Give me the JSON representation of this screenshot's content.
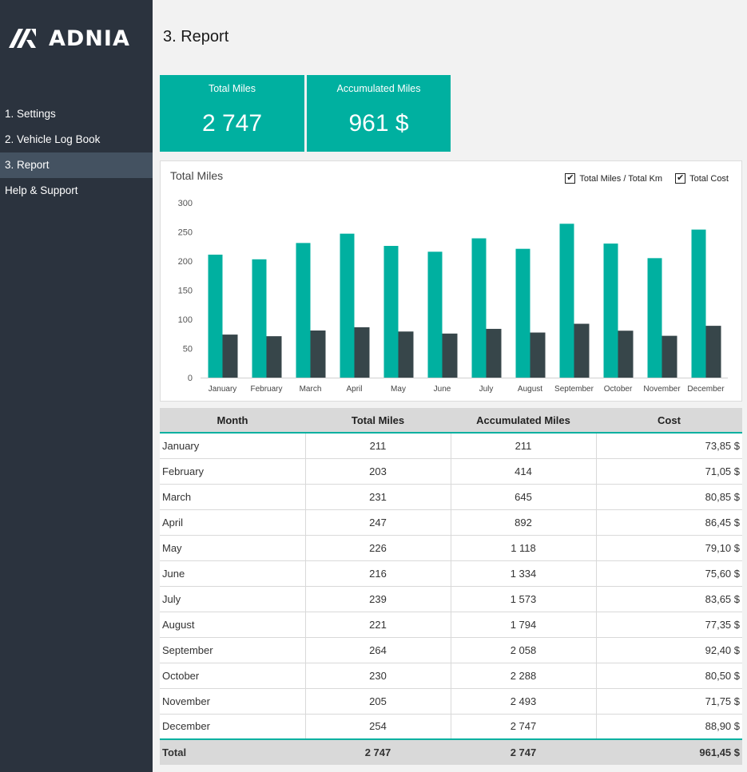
{
  "app": {
    "logo_text": "ADNIA",
    "page_title": "3. Report"
  },
  "sidebar": {
    "items": [
      {
        "label": "1. Settings",
        "active": false
      },
      {
        "label": "2. Vehicle Log Book",
        "active": false
      },
      {
        "label": "3. Report",
        "active": true
      },
      {
        "label": "Help & Support",
        "active": false
      }
    ]
  },
  "kpis": [
    {
      "label": "Total Miles",
      "value": "2 747"
    },
    {
      "label": "Accumulated Miles",
      "value": "961 $"
    }
  ],
  "colors": {
    "accent": "#00b0a0",
    "dark_series": "#37464a",
    "sidebar_bg": "#2b333e",
    "sidebar_active": "#445261"
  },
  "chart_legend": [
    {
      "label": "Total Miles / Total Km",
      "checked": true
    },
    {
      "label": "Total Cost",
      "checked": true
    }
  ],
  "chart_data": {
    "type": "bar",
    "title": "Total Miles",
    "xlabel": "",
    "ylabel": "",
    "ylim": [
      0,
      300
    ],
    "yticks": [
      0,
      50,
      100,
      150,
      200,
      250,
      300
    ],
    "grid": false,
    "legend": "top-right",
    "categories": [
      "January",
      "February",
      "March",
      "April",
      "May",
      "June",
      "July",
      "August",
      "September",
      "October",
      "November",
      "December"
    ],
    "series": [
      {
        "name": "Total Miles / Total Km",
        "color": "#00b0a0",
        "values": [
          211,
          203,
          231,
          247,
          226,
          216,
          239,
          221,
          264,
          230,
          205,
          254
        ]
      },
      {
        "name": "Total Cost",
        "color": "#37464a",
        "values": [
          73.85,
          71.05,
          80.85,
          86.45,
          79.1,
          75.6,
          83.65,
          77.35,
          92.4,
          80.5,
          71.75,
          88.9
        ]
      }
    ]
  },
  "table": {
    "headers": [
      "Month",
      "Total Miles",
      "Accumulated Miles",
      "Cost"
    ],
    "rows": [
      [
        "January",
        "211",
        "211",
        "73,85 $"
      ],
      [
        "February",
        "203",
        "414",
        "71,05 $"
      ],
      [
        "March",
        "231",
        "645",
        "80,85 $"
      ],
      [
        "April",
        "247",
        "892",
        "86,45 $"
      ],
      [
        "May",
        "226",
        "1 118",
        "79,10 $"
      ],
      [
        "June",
        "216",
        "1 334",
        "75,60 $"
      ],
      [
        "July",
        "239",
        "1 573",
        "83,65 $"
      ],
      [
        "August",
        "221",
        "1 794",
        "77,35 $"
      ],
      [
        "September",
        "264",
        "2 058",
        "92,40 $"
      ],
      [
        "October",
        "230",
        "2 288",
        "80,50 $"
      ],
      [
        "November",
        "205",
        "2 493",
        "71,75 $"
      ],
      [
        "December",
        "254",
        "2 747",
        "88,90 $"
      ]
    ],
    "total": [
      "Total",
      "2 747",
      "2 747",
      "961,45 $"
    ]
  }
}
